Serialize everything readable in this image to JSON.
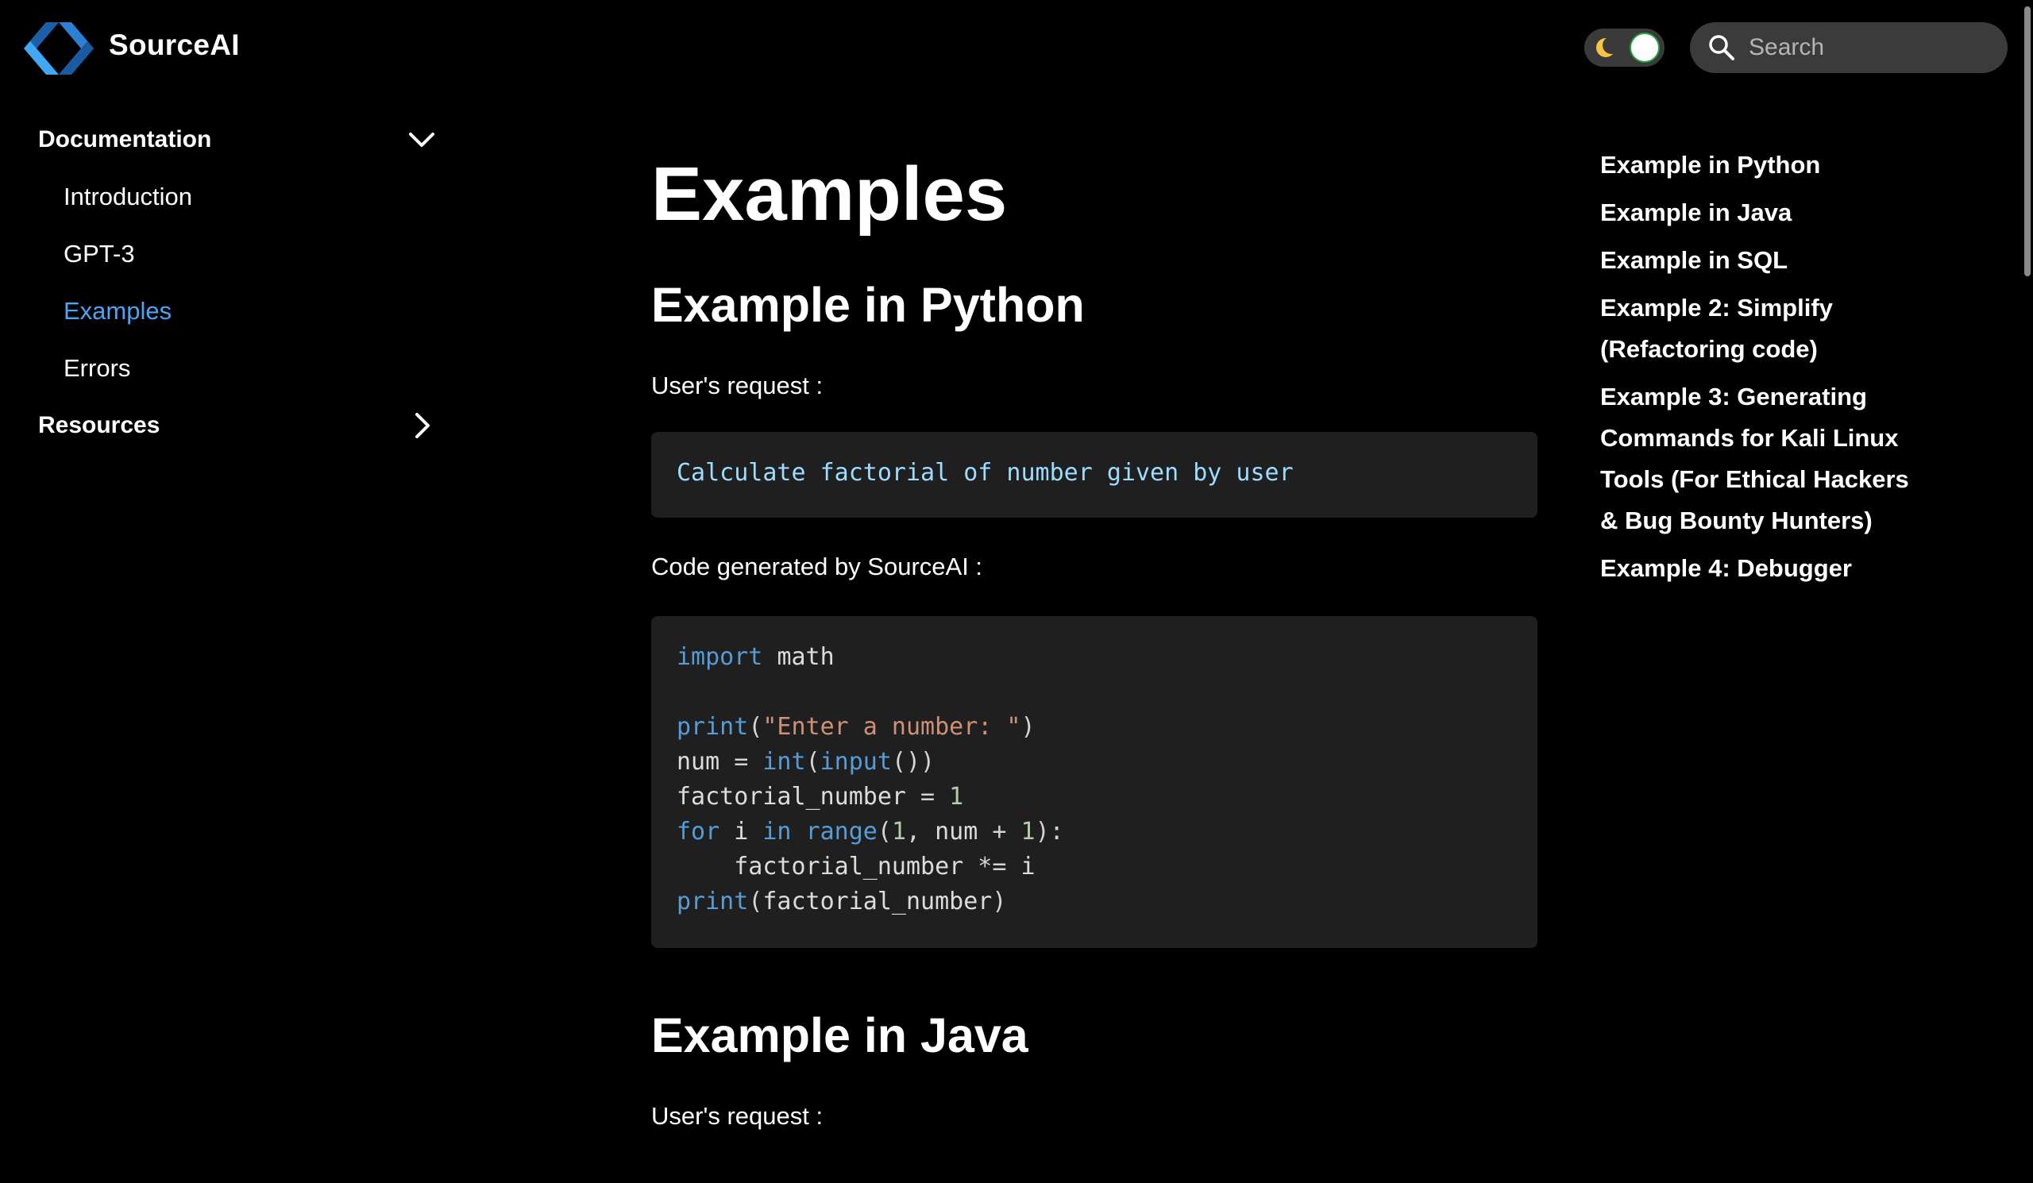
{
  "header": {
    "brand": "SourceAI",
    "search_placeholder": "Search",
    "theme_toggle_icon": "moon-icon",
    "colors": {
      "logo_light": "#3fa9f5",
      "logo_dark": "#1c5fa8",
      "toggle_border": "#24a148"
    }
  },
  "sidebar": {
    "groups": [
      {
        "label": "Documentation",
        "expanded": true,
        "items": [
          {
            "label": "Introduction",
            "active": false
          },
          {
            "label": "GPT-3",
            "active": false
          },
          {
            "label": "Examples",
            "active": true
          },
          {
            "label": "Errors",
            "active": false
          }
        ]
      },
      {
        "label": "Resources",
        "expanded": false,
        "items": []
      }
    ],
    "active_color": "#4ea3f4"
  },
  "main": {
    "title": "Examples",
    "python": {
      "heading": "Example in Python",
      "request_label": "User's request :",
      "request_text": "Calculate factorial of number given by user",
      "generated_label": "Code generated by SourceAI :",
      "code_lines": [
        "import math",
        "",
        "print(\"Enter a number: \")",
        "num = int(input())",
        "factorial_number = 1",
        "for i in range(1, num + 1):",
        "    factorial_number *= i",
        "print(factorial_number)"
      ]
    },
    "java": {
      "heading": "Example in Java",
      "request_label": "User's request :"
    }
  },
  "toc": {
    "links": [
      "Example in Python",
      "Example in Java",
      "Example in SQL",
      "Example 2: Simplify (Refactoring code)",
      "Example 3: Generating Commands for Kali Linux Tools (For Ethical Hackers & Bug Bounty Hunters)",
      "Example 4: Debugger"
    ]
  }
}
